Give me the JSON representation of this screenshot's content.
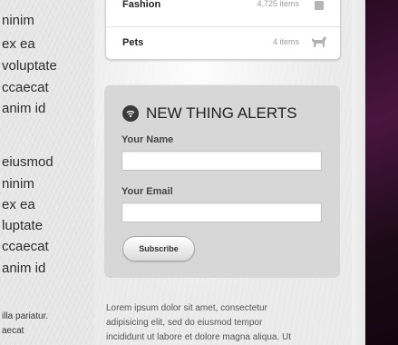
{
  "left_column": {
    "lines": [
      "ninim",
      "ex ea",
      "voluptate",
      "ccaecat",
      "anim id",
      "eiusmod",
      "ninim",
      "ex ea",
      "luptate",
      "ccaecat",
      "anim id"
    ],
    "small_lines": [
      "illa pariatur.",
      "aecat"
    ]
  },
  "categories": {
    "items": [
      {
        "name": "Fashion",
        "count": "4,725 items",
        "icon": "hanger-icon"
      },
      {
        "name": "Pets",
        "count": "4 items",
        "icon": "dog-icon"
      }
    ]
  },
  "alerts": {
    "icon": "wifi-icon",
    "title": "NEW THING ALERTS",
    "name_label": "Your Name",
    "name_value": "",
    "email_label": "Your Email",
    "email_value": "",
    "subscribe_label": "Subscribe"
  },
  "body_text": {
    "lines": [
      "Lorem ipsum dolor sit amet, consectetur",
      "adipisicing elit, sed do eiusmod tempor",
      "incididunt ut labore et dolore magna aliqua. Ut"
    ]
  },
  "colors": {
    "panel_bg": "#d7d7d7",
    "right_dark": "#3a0f32"
  }
}
